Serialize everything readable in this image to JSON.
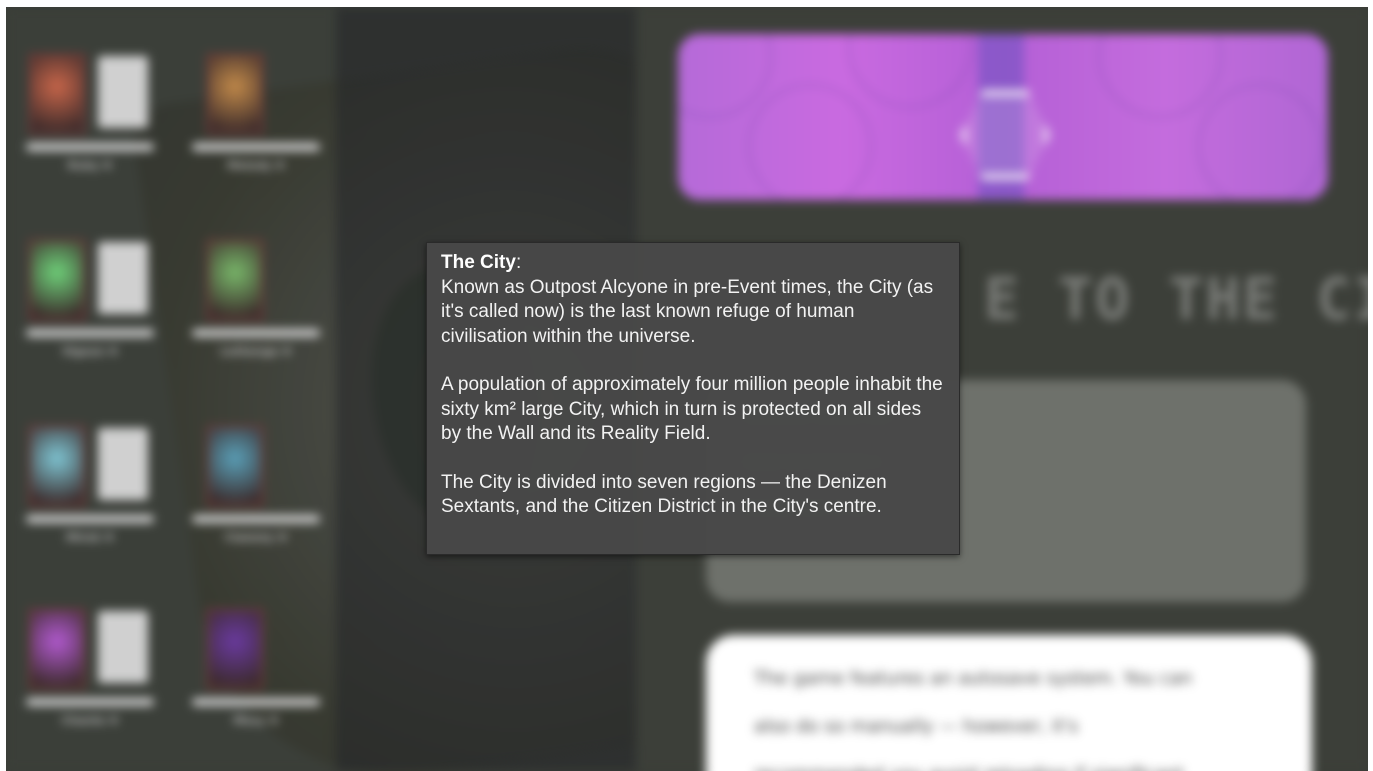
{
  "colors": {
    "background": "#3a3d37",
    "banner": "#c46cdd",
    "tooltip_bg": "#484848",
    "tooltip_text": "#f2f2f2",
    "portrait_border": "#6a3c3a"
  },
  "party": [
    {
      "name": "Ruby ✖",
      "portrait_color": "#c8664a",
      "card": "blank-card"
    },
    {
      "name": "Melody ✖",
      "portrait_color": "#c28a4a",
      "card": "none"
    },
    {
      "name": "Vigeon ✖",
      "portrait_color": "#6fd27a",
      "card": "blank-card"
    },
    {
      "name": "Lethenge ✖",
      "portrait_color": "#79b86a",
      "card": "none"
    },
    {
      "name": "Mirek ✖",
      "portrait_color": "#7fc6d4",
      "card": "blank-card"
    },
    {
      "name": "Clammy ✖",
      "portrait_color": "#5aa0b8",
      "card": "none"
    },
    {
      "name": "Chante ✖",
      "portrait_color": "#b25ad0",
      "card": "blank-card"
    },
    {
      "name": "Mosy ✖",
      "portrait_color": "#6a3aa0",
      "card": "none"
    }
  ],
  "banner": {
    "emblem_icon": "hexagon-emblem-icon"
  },
  "welcome": {
    "heading": "E TO THE CITY."
  },
  "info_box": {
    "lines": [
      "··········· ········ ····",
      "······ ··· ·········· ·",
      "········ ····· ·· ···"
    ]
  },
  "save_notice": {
    "lines": [
      "The game features an autosave system. You can",
      "also do so manually — however, it's",
      "recommended you avoid reloading if significant"
    ]
  },
  "tooltip": {
    "title": "The City",
    "title_suffix": ":",
    "paragraph1": "Known as Outpost Alcyone in pre-Event times, the City (as it's called now) is the last known refuge of human civilisation within the universe.",
    "paragraph2": "A population of approximately four million people inhabit the sixty km² large City, which in turn is protected on all sides by the Wall and its Reality Field.",
    "paragraph3": "The City is divided into seven regions — the Denizen Sextants, and the Citizen District in the City's centre."
  }
}
